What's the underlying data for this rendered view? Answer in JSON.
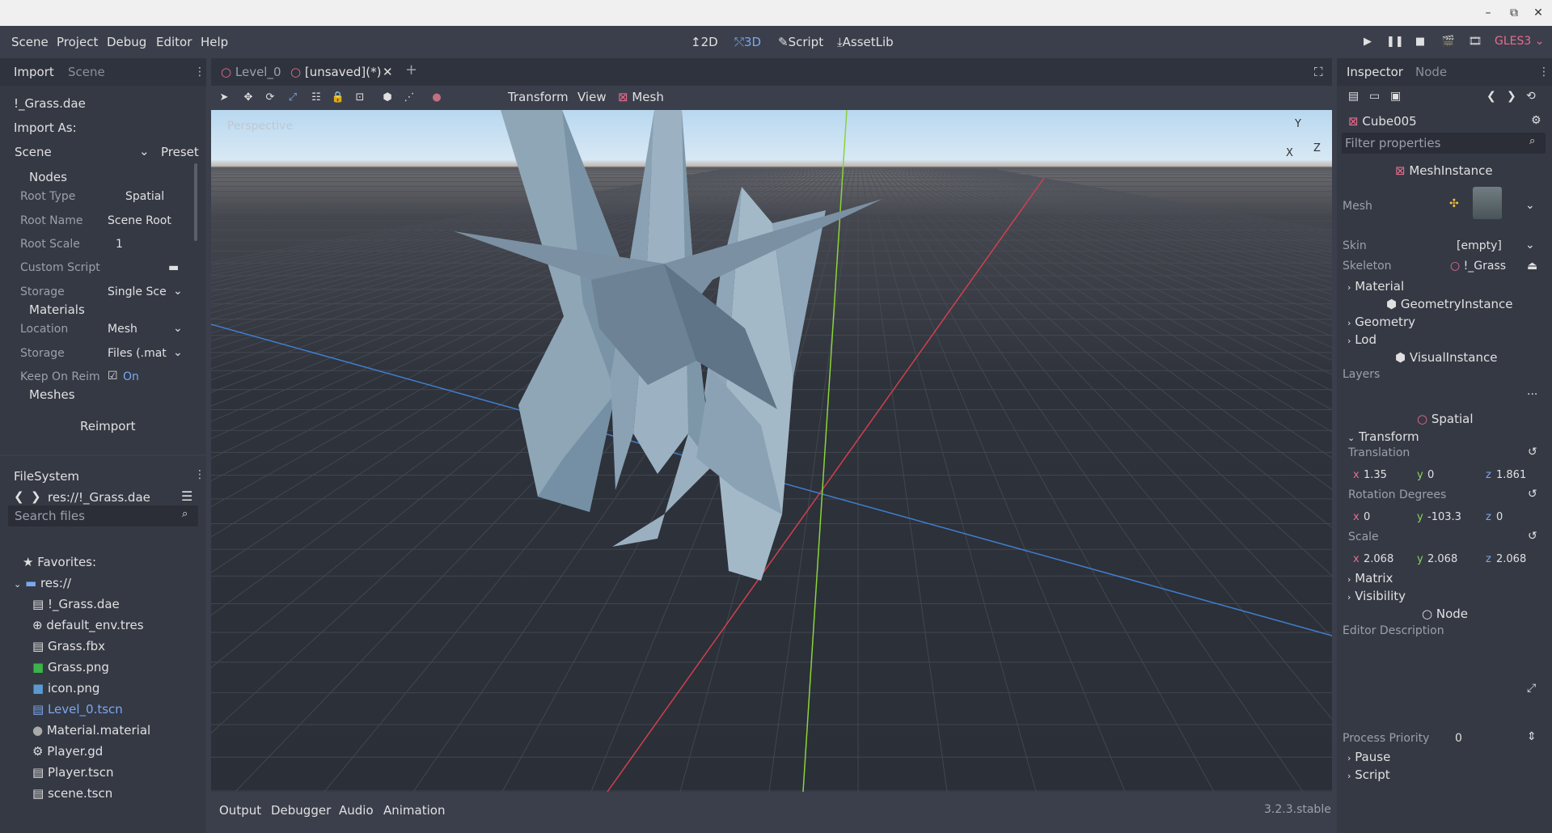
{
  "menubar": {
    "menus": [
      "Scene",
      "Project",
      "Debug",
      "Editor",
      "Help"
    ],
    "workspaces": [
      "2D",
      "3D",
      "Script",
      "AssetLib"
    ],
    "active_workspace": "3D",
    "renderer": "GLES3"
  },
  "import_dock": {
    "tabs": [
      "Import",
      "Scene"
    ],
    "file": "!_Grass.dae",
    "import_as_label": "Import As:",
    "import_as_value": "Scene",
    "preset_label": "Preset",
    "nodes_section": "Nodes",
    "props": [
      {
        "label": "Root Type",
        "value": "Spatial"
      },
      {
        "label": "Root Name",
        "value": "Scene Root"
      },
      {
        "label": "Root Scale",
        "value": "1"
      },
      {
        "label": "Custom Script",
        "value": ""
      },
      {
        "label": "Storage",
        "value": "Single Sce"
      }
    ],
    "materials_section": "Materials",
    "mat_props": [
      {
        "label": "Location",
        "value": "Mesh"
      },
      {
        "label": "Storage",
        "value": "Files (.mat"
      },
      {
        "label": "Keep On Reim",
        "value": "On"
      }
    ],
    "meshes_section": "Meshes",
    "reimport_label": "Reimport"
  },
  "filesystem": {
    "title": "FileSystem",
    "path": "res://!_Grass.dae",
    "search_placeholder": "Search files",
    "favorites_label": "Favorites:",
    "root_label": "res://",
    "files": [
      {
        "name": "!_Grass.dae",
        "icon": "scene-icon",
        "highlight": false,
        "selected": true
      },
      {
        "name": "default_env.tres",
        "icon": "environment-icon",
        "highlight": false,
        "selected": false
      },
      {
        "name": "Grass.fbx",
        "icon": "scene-icon",
        "highlight": false,
        "selected": false
      },
      {
        "name": "Grass.png",
        "icon": "image-icon",
        "highlight": false,
        "selected": false
      },
      {
        "name": "icon.png",
        "icon": "image-icon",
        "highlight": false,
        "selected": false
      },
      {
        "name": "Level_0.tscn",
        "icon": "scene-icon",
        "highlight": true,
        "selected": false
      },
      {
        "name": "Material.material",
        "icon": "material-icon",
        "highlight": false,
        "selected": false
      },
      {
        "name": "Player.gd",
        "icon": "gear-icon",
        "highlight": false,
        "selected": false
      },
      {
        "name": "Player.tscn",
        "icon": "scene-icon",
        "highlight": false,
        "selected": false
      },
      {
        "name": "scene.tscn",
        "icon": "scene-icon",
        "highlight": false,
        "selected": false
      }
    ]
  },
  "editor": {
    "tabs": [
      "Level_0",
      "[unsaved](*)"
    ],
    "toolbar_menus": [
      "Transform",
      "View",
      "Mesh"
    ],
    "viewport_label": "Perspective",
    "gizmo_labels": [
      "Y",
      "X",
      "Z"
    ]
  },
  "bottom_panel": {
    "tabs": [
      "Output",
      "Debugger",
      "Audio",
      "Animation"
    ],
    "version": "3.2.3.stable"
  },
  "inspector": {
    "tabs": [
      "Inspector",
      "Node"
    ],
    "node_name": "Cube005",
    "filter_placeholder": "Filter properties",
    "class_mesh_instance": "MeshInstance",
    "mesh_label": "Mesh",
    "skin_label": "Skin",
    "skin_value": "[empty]",
    "skeleton_label": "Skeleton",
    "skeleton_value": "!_Grass",
    "material_section": "Material",
    "class_geometry_instance": "GeometryInstance",
    "geometry_section": "Geometry",
    "lod_section": "Lod",
    "class_visual_instance": "VisualInstance",
    "layers_label": "Layers",
    "layers_more": "...",
    "class_spatial": "Spatial",
    "transform_section": "Transform",
    "translation_label": "Translation",
    "translation": {
      "x": "1.35",
      "y": "0",
      "z": "1.861"
    },
    "rotation_label": "Rotation Degrees",
    "rotation": {
      "x": "0",
      "y": "-103.3",
      "z": "0"
    },
    "scale_label": "Scale",
    "scale": {
      "x": "2.068",
      "y": "2.068",
      "z": "2.068"
    },
    "matrix_section": "Matrix",
    "visibility_section": "Visibility",
    "class_node": "Node",
    "editor_description_label": "Editor Description",
    "process_priority_label": "Process Priority",
    "process_priority_value": "0",
    "pause_section": "Pause",
    "script_section": "Script"
  },
  "colors": {
    "axis_x": "#e96d8c",
    "axis_y": "#8ad45a",
    "axis_z": "#7aa8f0",
    "accent": "#7aa8f0"
  }
}
